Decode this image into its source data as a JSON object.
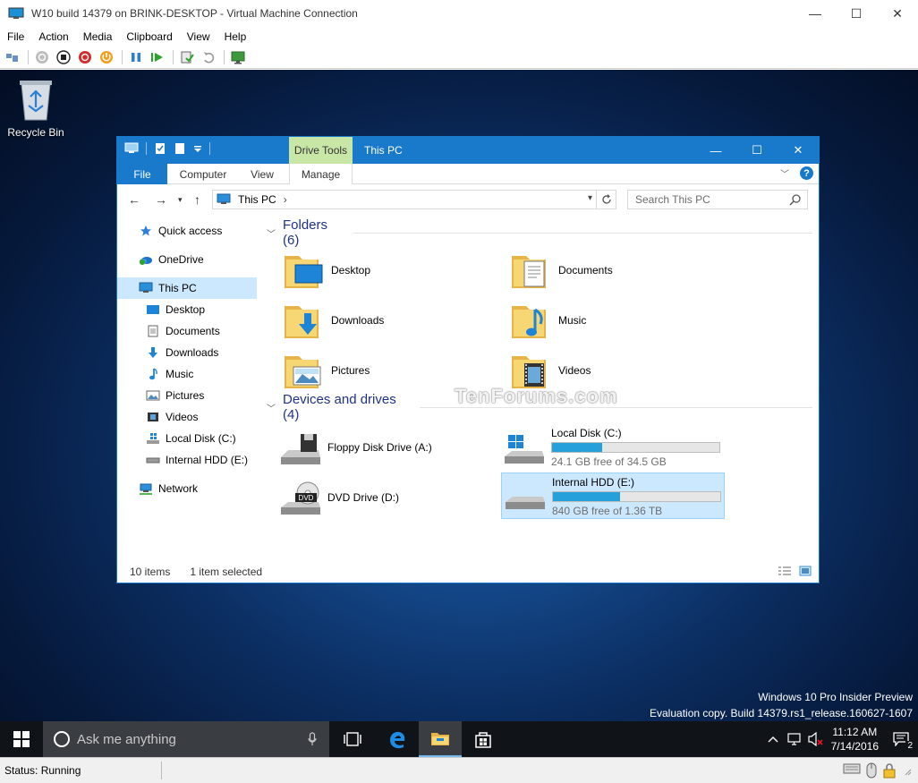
{
  "vm": {
    "title": "W10 build 14379 on BRINK-DESKTOP - Virtual Machine Connection",
    "menu": [
      "File",
      "Action",
      "Media",
      "Clipboard",
      "View",
      "Help"
    ],
    "status": "Status: Running"
  },
  "desktop": {
    "recycle_bin_label": "Recycle Bin",
    "watermark_line1": "Windows 10 Pro Insider Preview",
    "watermark_line2": "Evaluation copy. Build 14379.rs1_release.160627-1607",
    "site_watermark": "TenForums.com"
  },
  "explorer": {
    "title": "This PC",
    "context_tab": "Drive Tools",
    "ribbon_tabs": [
      "File",
      "Computer",
      "View",
      "Manage"
    ],
    "address_crumb": "This PC",
    "search_placeholder": "Search This PC",
    "nav_items": [
      "Quick access",
      "OneDrive",
      "This PC",
      "Desktop",
      "Documents",
      "Downloads",
      "Music",
      "Pictures",
      "Videos",
      "Local Disk (C:)",
      "Internal HDD (E:)",
      "Network"
    ],
    "folders_header": "Folders (6)",
    "folders": [
      "Desktop",
      "Documents",
      "Downloads",
      "Music",
      "Pictures",
      "Videos"
    ],
    "devices_header": "Devices and drives (4)",
    "drives": [
      {
        "name": "Floppy Disk Drive (A:)"
      },
      {
        "name": "Local Disk (C:)",
        "free": "24.1 GB free of 34.5 GB",
        "used_fraction": 0.3
      },
      {
        "name": "DVD Drive (D:)"
      },
      {
        "name": "Internal HDD (E:)",
        "free": "840 GB free of 1.36 TB",
        "used_fraction": 0.4
      }
    ],
    "status_items": "10 items",
    "status_selected": "1 item selected"
  },
  "taskbar": {
    "search_placeholder": "Ask me anything",
    "time": "11:12 AM",
    "date": "7/14/2016",
    "notification_count": "2"
  },
  "colors": {
    "accent": "#1979ca",
    "drive_tools": "#c8e7a6",
    "selection": "#cce8ff",
    "bar_fill": "#26a0da"
  }
}
